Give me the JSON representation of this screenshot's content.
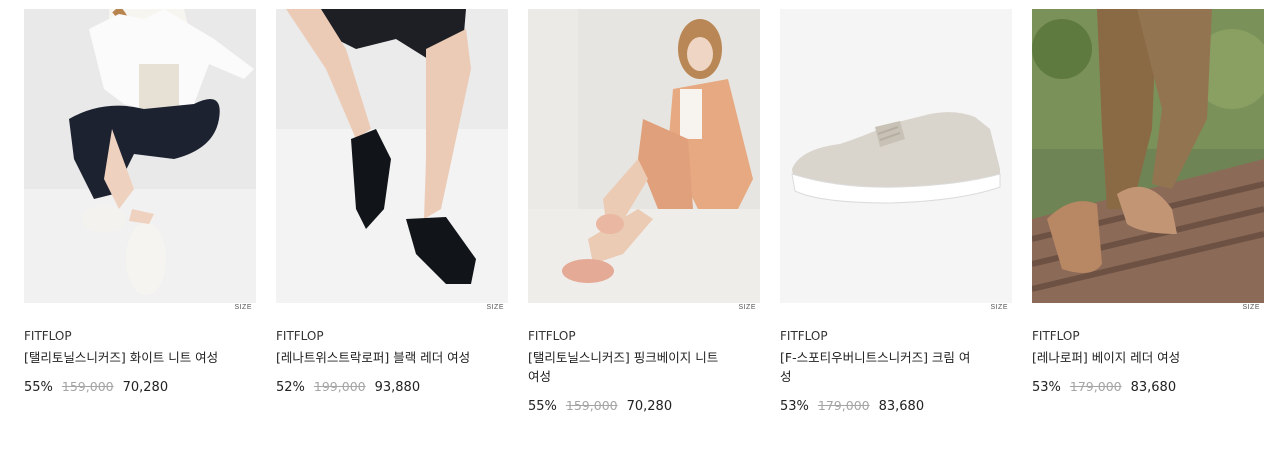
{
  "products": [
    {
      "image_alt": "model in white shirt and black pants wearing white knit sneakers",
      "size_label": "SIZE",
      "brand": "FITFLOP",
      "name": "[탤리토닐스니커즈] 화이트 니트 여성",
      "discount": "55%",
      "original_price": "159,000",
      "sale_price": "70,280"
    },
    {
      "image_alt": "legs in black shorts wearing black leather loafers",
      "size_label": "SIZE",
      "brand": "FITFLOP",
      "name": "[레나트위스트락로퍼] 블랙 레더 여성",
      "discount": "52%",
      "original_price": "199,000",
      "sale_price": "93,880"
    },
    {
      "image_alt": "model in peach blazer wearing pink-beige knit sneakers",
      "size_label": "SIZE",
      "brand": "FITFLOP",
      "name": "[탤리토닐스니커즈] 핑크베이지 니트 여성",
      "discount": "55%",
      "original_price": "159,000",
      "sale_price": "70,280"
    },
    {
      "image_alt": "cream knit sneaker on white background",
      "size_label": "SIZE",
      "brand": "FITFLOP",
      "name": "[F-스포티우버니트스니커즈] 크림 여성",
      "discount": "53%",
      "original_price": "179,000",
      "sale_price": "83,680"
    },
    {
      "image_alt": "legs in olive trousers wearing beige leather loafers on wooden stairs",
      "size_label": "SIZE",
      "brand": "FITFLOP",
      "name": "[레나로퍼] 베이지 레더 여성",
      "discount": "53%",
      "original_price": "179,000",
      "sale_price": "83,680"
    }
  ]
}
